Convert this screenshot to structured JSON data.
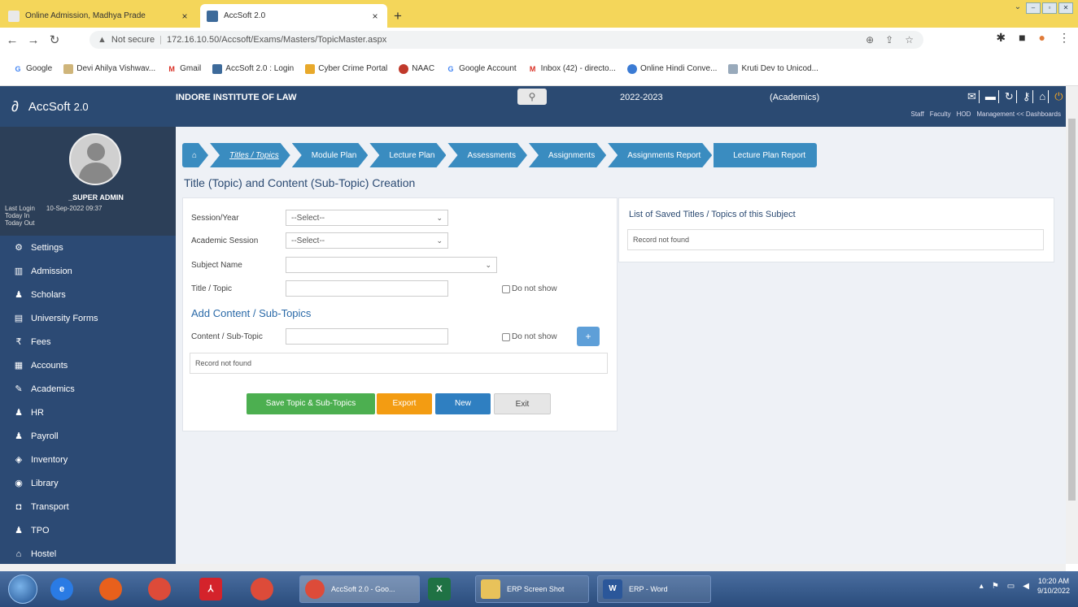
{
  "browser": {
    "tabs": [
      {
        "title": "Online Admission, Madhya Prade",
        "active": false
      },
      {
        "title": "AccSoft 2.0",
        "active": true
      }
    ],
    "security": "Not secure",
    "url": "172.16.10.50/Accsoft/Exams/Masters/TopicMaster.aspx",
    "bookmarks": [
      "Google",
      "Devi Ahilya Vishwav...",
      "Gmail",
      "AccSoft 2.0 : Login",
      "Cyber Crime Portal",
      "NAAC",
      "Google Account",
      "Inbox (42) - directo...",
      "Online Hindi Conve...",
      "Kruti Dev to Unicod..."
    ]
  },
  "app": {
    "name": "AccSoft",
    "version": "2.0",
    "institute": "INDORE INSTITUTE OF LAW",
    "year": "2022-2023",
    "module": "(Academics)",
    "top_links": [
      "Staff",
      "Faculty",
      "HOD",
      "Management << Dashboards"
    ]
  },
  "user": {
    "name": "_SUPER ADMIN",
    "last_login_label": "Last Login",
    "last_login_value": "10-Sep-2022 09:37",
    "today_in": "Today In",
    "today_out": "Today Out"
  },
  "menu": [
    {
      "label": "Settings",
      "icon": "gear-icon"
    },
    {
      "label": "Admission",
      "icon": "admission-icon"
    },
    {
      "label": "Scholars",
      "icon": "user-icon"
    },
    {
      "label": "University Forms",
      "icon": "form-icon"
    },
    {
      "label": "Fees",
      "icon": "rupee-icon"
    },
    {
      "label": "Accounts",
      "icon": "accounts-icon"
    },
    {
      "label": "Academics",
      "icon": "pen-icon"
    },
    {
      "label": "HR",
      "icon": "hr-icon"
    },
    {
      "label": "Payroll",
      "icon": "payroll-icon"
    },
    {
      "label": "Inventory",
      "icon": "inventory-icon"
    },
    {
      "label": "Library",
      "icon": "library-icon"
    },
    {
      "label": "Transport",
      "icon": "car-icon"
    },
    {
      "label": "TPO",
      "icon": "user-icon"
    },
    {
      "label": "Hostel",
      "icon": "home-icon"
    }
  ],
  "breadcrumb": [
    "Titles / Topics",
    "Module Plan",
    "Lecture Plan",
    "Assessments",
    "Assignments",
    "Assignments Report",
    "Lecture Plan Report"
  ],
  "page_title": "Title (Topic) and Content (Sub-Topic) Creation",
  "form": {
    "session_year_label": "Session/Year",
    "session_year_value": "--Select--",
    "academic_session_label": "Academic Session",
    "academic_session_value": "--Select--",
    "subject_label": "Subject Name",
    "subject_value": "",
    "title_label": "Title / Topic",
    "do_not_show": "Do not show",
    "subhead": "Add Content / Sub-Topics",
    "content_label": "Content / Sub-Topic",
    "plus": "+",
    "record_not_found": "Record not found"
  },
  "buttons": {
    "save": "Save Topic & Sub-Topics",
    "export": "Export",
    "new": "New",
    "exit": "Exit"
  },
  "saved_list": {
    "title": "List of Saved Titles / Topics of this Subject",
    "empty": "Record not found"
  },
  "taskbar": {
    "tasks": [
      "AccSoft 2.0 - Goo...",
      "ERP Screen Shot",
      "ERP - Word"
    ],
    "time": "10:20 AM",
    "date": "9/10/2022"
  }
}
